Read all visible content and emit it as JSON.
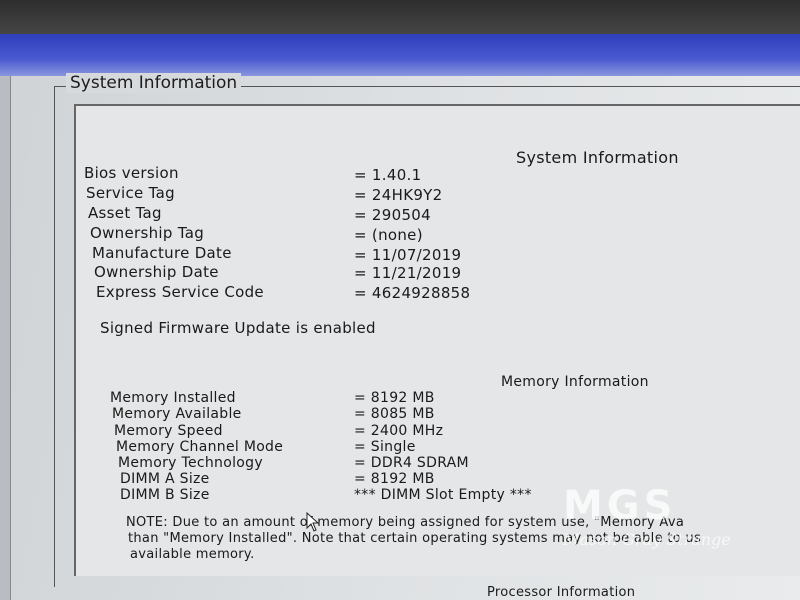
{
  "group_title": "System Information",
  "system_heading": "System Information",
  "system_rows": [
    {
      "label": "Bios version",
      "value": "= 1.40.1"
    },
    {
      "label": "Service Tag",
      "value": "= 24HK9Y2"
    },
    {
      "label": "Asset Tag",
      "value": "= 290504"
    },
    {
      "label": "Ownership Tag",
      "value": "= (none)"
    },
    {
      "label": "Manufacture Date",
      "value": "= 11/07/2019"
    },
    {
      "label": "Ownership Date",
      "value": "= 11/21/2019"
    },
    {
      "label": "Express Service Code",
      "value": "= 4624928858"
    }
  ],
  "firmware_note": "Signed Firmware Update is enabled",
  "memory_heading": "Memory Information",
  "memory_rows": [
    {
      "label": "Memory Installed",
      "value": "= 8192 MB"
    },
    {
      "label": "Memory Available",
      "value": "= 8085 MB"
    },
    {
      "label": "Memory Speed",
      "value": "= 2400 MHz"
    },
    {
      "label": "Memory Channel Mode",
      "value": "= Single"
    },
    {
      "label": "Memory Technology",
      "value": "= DDR4 SDRAM"
    },
    {
      "label": "DIMM A Size",
      "value": "= 8192 MB"
    },
    {
      "label": "DIMM B Size",
      "value": "*** DIMM Slot Empty ***"
    }
  ],
  "memory_note": {
    "line1": "NOTE: Due to an amount of memory being assigned for system use, \"Memory Ava",
    "line2": "than \"Memory Installed\". Note that certain operating systems may not be able to us",
    "line3": "available memory."
  },
  "processor_heading": "Processor Information",
  "watermark": {
    "logo": "MGS",
    "name": "Mason Gray Strange"
  }
}
